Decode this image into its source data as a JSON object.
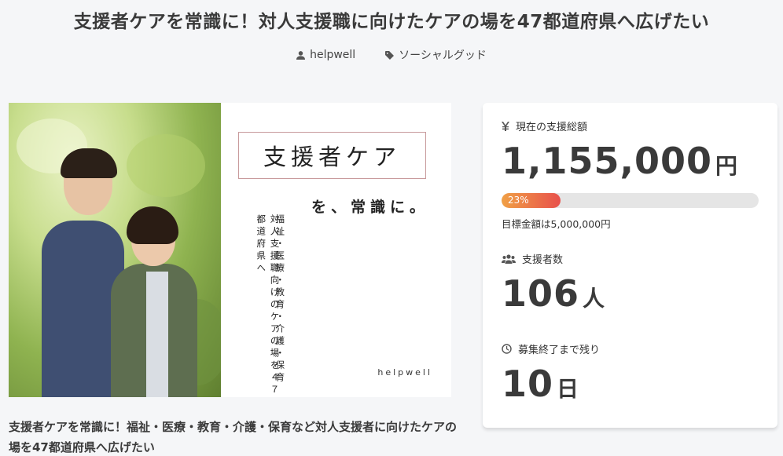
{
  "page": {
    "title": "支援者ケアを常識に！対人支援職に向けたケアの場を47都道府県へ広げたい",
    "author": "helpwell",
    "category": "ソーシャルグッド"
  },
  "hero": {
    "headline": "支援者ケア",
    "tagline": "を、常識に。",
    "column_1": "福祉・医療・教育・介護・保育",
    "column_2": "対人支援職向けのケアの場を４７都道府県へ",
    "brand": "helpwell"
  },
  "description": "支援者ケアを常識に！福祉・医療・教育・介護・保育など対人支援者に向けたケアの場を47都道府県へ広げたい",
  "stats": {
    "total": {
      "icon": "yen-icon",
      "label": "現在の支援総額",
      "value": "1,155,000",
      "unit": "円",
      "progress_percent": 23,
      "progress_label": "23%",
      "goal_text": "目標金額は5,000,000円"
    },
    "supporters": {
      "icon": "users-icon",
      "label": "支援者数",
      "value": "106",
      "unit": "人"
    },
    "remaining": {
      "icon": "clock-icon",
      "label": "募集終了まで残り",
      "value": "10",
      "unit": "日"
    }
  },
  "colors": {
    "progress_start": "#f0a045",
    "progress_end": "#e8504b",
    "background": "#f5f6f8"
  }
}
